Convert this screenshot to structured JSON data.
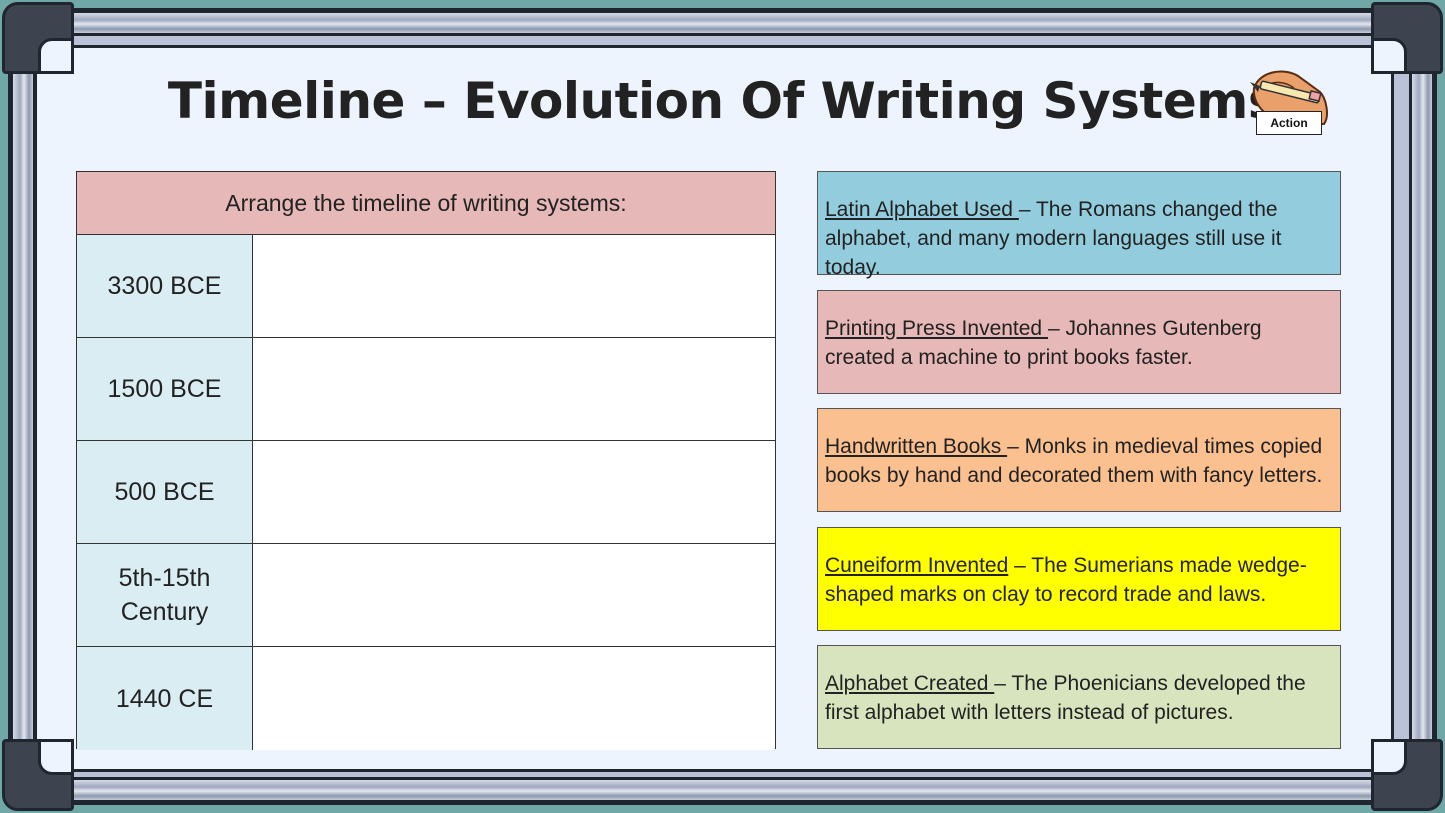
{
  "title": "Timeline – Evolution Of Writing Systems",
  "action": {
    "label": "Action",
    "icon": "hand-pencil-icon"
  },
  "table": {
    "header": "Arrange the timeline of writing systems:",
    "rows": [
      {
        "date": "3300 BCE",
        "answer": ""
      },
      {
        "date": "1500 BCE",
        "answer": ""
      },
      {
        "date": "500 BCE",
        "answer": ""
      },
      {
        "date": "5th-15th Century",
        "answer": ""
      },
      {
        "date": "1440 CE",
        "answer": ""
      }
    ]
  },
  "cards": [
    {
      "heading": "Latin Alphabet Used ",
      "text": "– The Romans changed the alphabet, and many modern languages still use it today.",
      "color": "#93cddd"
    },
    {
      "heading": "Printing Press Invented ",
      "text": "– Johannes Gutenberg created a machine to print books faster.",
      "color": "#e6b8b7"
    },
    {
      "heading": "Handwritten Books ",
      "text": "– Monks in medieval times copied books by hand and decorated them with fancy letters.",
      "color": "#fac090"
    },
    {
      "heading": "Cuneiform Invented",
      "text": " – The Sumerians made wedge-shaped marks on clay to record trade and laws.",
      "color": "#ffff00"
    },
    {
      "heading": "Alphabet Created ",
      "text": "– The Phoenicians developed the first alphabet with letters instead of pictures.",
      "color": "#d7e4bd"
    }
  ],
  "colors": {
    "frame": "#b9c2d6",
    "board": "#eef4fd",
    "background": "#6fa8a6"
  }
}
